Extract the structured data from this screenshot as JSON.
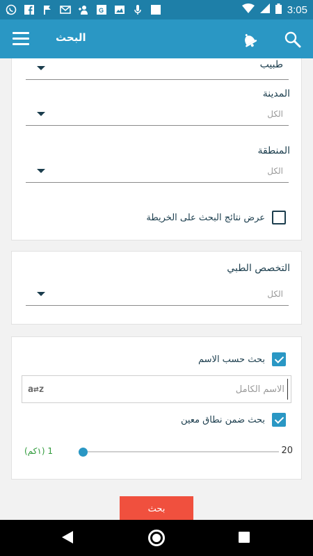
{
  "status_bar": {
    "time": "3:05",
    "icons": [
      "whatsapp-icon",
      "facebook-icon",
      "flag-icon",
      "gmail-icon",
      "add-person-icon",
      "maps-icon",
      "image-icon",
      "mic-icon",
      "square-icon"
    ]
  },
  "app_bar": {
    "title": "البحث"
  },
  "filters": {
    "doctor_type": {
      "value": "طبيب"
    },
    "city": {
      "label": "المدينة",
      "value": "الكل"
    },
    "region": {
      "label": "المنطقة",
      "value": "الكل"
    },
    "show_on_map": {
      "label": "عرض نتائج البحث على الخريطة",
      "checked": false
    }
  },
  "specialty": {
    "label": "التخصص الطبي",
    "value": "الكل"
  },
  "name_search": {
    "by_name_label": "بحث حسب الاسم",
    "by_name_checked": true,
    "full_name_placeholder": "الاسم الكامل",
    "az_icon_text": "a⇄z",
    "range_label": "بحث ضمن نطاق معين",
    "range_checked": true,
    "range_value_text": "(١كم) 1",
    "range_max": "20",
    "range_fraction": 0.0
  },
  "search_button_label": "بحث",
  "colors": {
    "primary": "#2a97c4",
    "status_bar": "#1e7fa8",
    "search_button": "#f0503e",
    "range_text": "#2e9a3a"
  }
}
